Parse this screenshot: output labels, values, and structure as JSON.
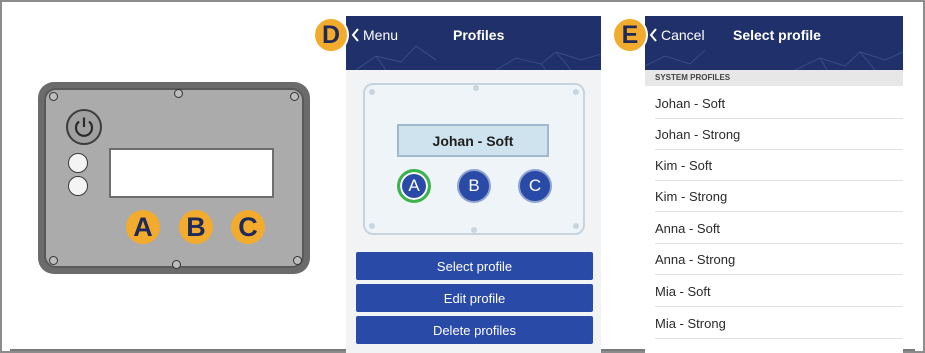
{
  "callouts": {
    "d": "D",
    "e": "E"
  },
  "device": {
    "buttons": [
      "A",
      "B",
      "C"
    ]
  },
  "profiles_screen": {
    "back_label": "Menu",
    "title": "Profiles",
    "current_profile": "Johan - Soft",
    "profile_buttons": [
      "A",
      "B",
      "C"
    ],
    "active_button": "A",
    "actions": [
      "Select profile",
      "Edit profile",
      "Delete profiles"
    ]
  },
  "select_screen": {
    "back_label": "Cancel",
    "title": "Select profile",
    "section_header": "SYSTEM PROFILES",
    "items": [
      "Johan - Soft",
      "Johan - Strong",
      "Kim - Soft",
      "Kim - Strong",
      "Anna - Soft",
      "Anna - Strong",
      "Mia - Soft",
      "Mia - Strong"
    ]
  },
  "colors": {
    "header_navy": "#20306a",
    "button_blue": "#2a4aa8",
    "callout_orange": "#f3ab2e",
    "active_green": "#3bb54a",
    "device_gray": "#ababab"
  }
}
